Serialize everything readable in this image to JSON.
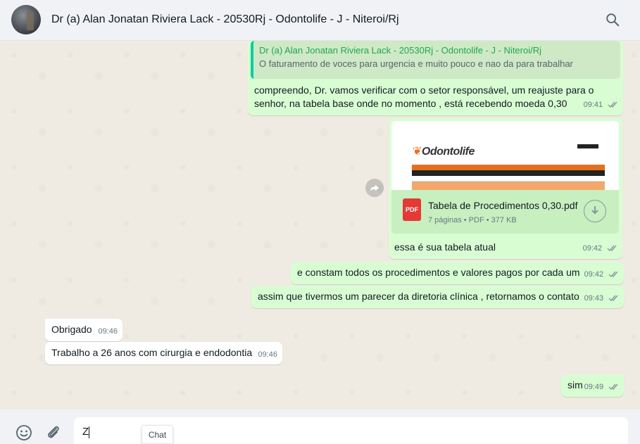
{
  "header": {
    "title": "Dr (a) Alan Jonatan Riviera Lack - 20530Rj - Odontolife - J - Niteroi/Rj",
    "search_icon": "search-icon"
  },
  "messages": {
    "m1": {
      "quote_author": "Dr (a) Alan Jonatan Riviera Lack - 20530Rj - Odontolife - J - Niteroi/Rj",
      "quote_text": "O faturamento de voces para urgencia e muito pouco e nao da para trabalhar",
      "line1": "compreendo, Dr. vamos verificar com o setor responsável, um reajuste para o",
      "line2": "senhor, na tabela base onde no momento , está recebendo moeda 0,30",
      "time": "09:41"
    },
    "m2": {
      "doc_logo": "Odontolife",
      "pdf_label": "PDF",
      "doc_name": "Tabela de Procedimentos 0,30.pdf",
      "doc_meta": "7 páginas • PDF • 377 KB",
      "caption": "essa é sua tabela atual",
      "time": "09:42"
    },
    "m3": {
      "text": "e constam todos os procedimentos e valores pagos por cada um",
      "time": "09:42"
    },
    "m4": {
      "text": "assim que tivermos um parecer da diretoria clínica , retornamos o contato",
      "time": "09:43"
    },
    "m5": {
      "text": "Obrigado",
      "time": "09:46"
    },
    "m6": {
      "text": "Trabalho a 26 anos com cirurgia e endodontia",
      "time": "09:46"
    },
    "m7": {
      "text": "sim",
      "time": "09:49"
    }
  },
  "composer": {
    "value": "Z",
    "tooltip": "Chat"
  },
  "colors": {
    "outgoing_bubble": "#d9fdd3",
    "incoming_bubble": "#ffffff",
    "read_ticks": "#8696a0",
    "quote_accent": "#06cf9c"
  }
}
